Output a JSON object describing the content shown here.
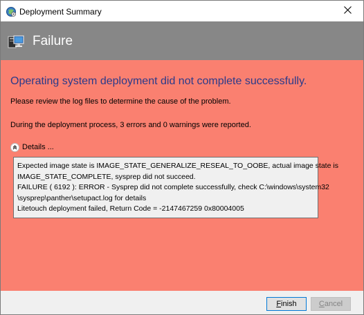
{
  "window": {
    "title": "Deployment Summary",
    "close_glyph": "✕"
  },
  "header": {
    "title": "Failure",
    "icon": "computer-icon",
    "color": "#878787"
  },
  "content": {
    "background": "#fa8070",
    "heading": "Operating system deployment did not complete successfully.",
    "review_text": "Please review the log files to determine the cause of the problem.",
    "summary_text": "During the deployment process, 3 errors and 0 warnings were reported.",
    "details_label": "Details ...",
    "details_lines": [
      "Expected image state is IMAGE_STATE_GENERALIZE_RESEAL_TO_OOBE, actual image state is",
      "IMAGE_STATE_COMPLETE, sysprep did not succeed.",
      "FAILURE ( 6192 ): ERROR - Sysprep did not complete successfully, check C:\\windows\\system32",
      "\\sysprep\\panther\\setupact.log for details",
      "Litetouch deployment failed, Return Code = -2147467259  0x80004005"
    ]
  },
  "footer": {
    "finish_mnemonic": "F",
    "finish_rest": "inish",
    "cancel_mnemonic": "C",
    "cancel_rest": "ancel"
  }
}
